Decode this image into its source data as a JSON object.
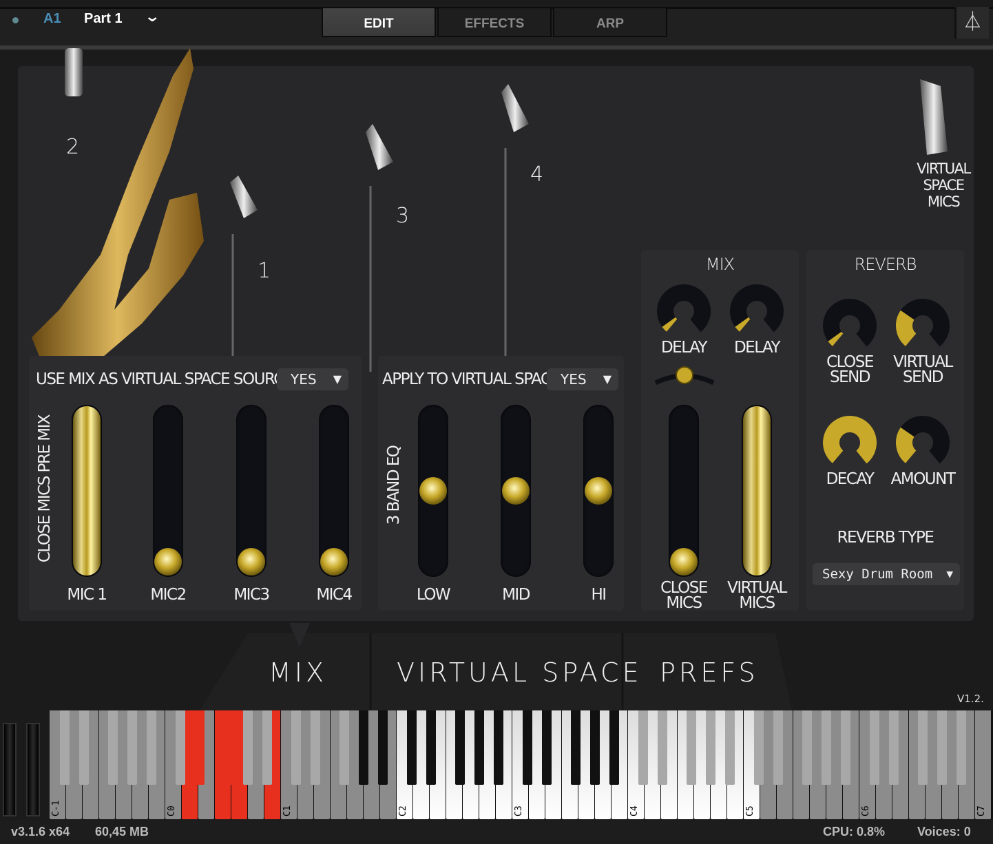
{
  "header": {
    "part_id": "A1",
    "part_name": "Part 1",
    "tabs": [
      {
        "label": "EDIT",
        "active": true
      },
      {
        "label": "EFFECTS",
        "active": false
      },
      {
        "label": "ARP",
        "active": false
      }
    ],
    "metronome_icon": "metronome-icon"
  },
  "stage": {
    "mic_numbers": [
      "2",
      "1",
      "3",
      "4"
    ],
    "virtual_space_mics": "VIRTUAL\nSPACE\nMICS"
  },
  "close_mics": {
    "source_label": "USE MIX AS VIRTUAL SPACE SOURCE",
    "source_value": "YES",
    "side_label": "CLOSE MICS PRE MIX",
    "faders": [
      {
        "label": "MIC 1",
        "value": 1.0
      },
      {
        "label": "MIC2",
        "value": 0
      },
      {
        "label": "MIC3",
        "value": 0
      },
      {
        "label": "MIC4",
        "value": 0
      }
    ]
  },
  "eq": {
    "apply_label": "APPLY TO VIRTUAL SPACE",
    "apply_value": "YES",
    "side_label": "3 BAND EQ",
    "faders": [
      {
        "label": "LOW",
        "value": 0.5
      },
      {
        "label": "MID",
        "value": 0.5
      },
      {
        "label": "HI",
        "value": 0.5
      }
    ]
  },
  "mix": {
    "title": "MIX",
    "knobs": [
      {
        "label": "DELAY",
        "value": 0.05
      },
      {
        "label": "DELAY",
        "value": 0.05
      }
    ],
    "balance": 0.5,
    "faders": [
      {
        "label": "CLOSE\nMICS",
        "value": 0
      },
      {
        "label": "VIRTUAL\nMICS",
        "value": 1.0
      }
    ]
  },
  "reverb": {
    "title": "REVERB",
    "knobs": [
      {
        "label": "CLOSE\nSEND",
        "value": 0.05
      },
      {
        "label": "VIRTUAL\nSEND",
        "value": 0.3
      },
      {
        "label": "DECAY",
        "value": 1.0
      },
      {
        "label": "AMOUNT",
        "value": 0.3
      }
    ],
    "type_label": "REVERB TYPE",
    "type_value": "Sexy Drum Room"
  },
  "bottom_tabs": [
    "MIX",
    "VIRTUAL SPACE",
    "PREFS"
  ],
  "version_tag": "V1.2.",
  "keyboard": {
    "octave_labels": [
      "C-1",
      "C0",
      "C1",
      "C2",
      "C3",
      "C4",
      "C5",
      "C6",
      "C7"
    ],
    "pressed_colour": "#e8301f",
    "gold": "#c8a92a"
  },
  "status": {
    "version": "v3.1.6 x64",
    "memory": "60,45 MB",
    "cpu": "CPU: 0.8%",
    "voices": "Voices: 0"
  }
}
